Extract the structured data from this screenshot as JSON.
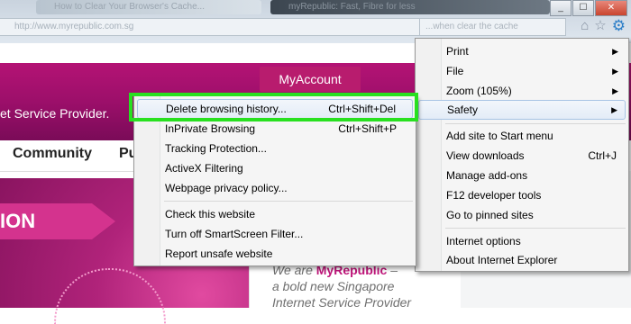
{
  "browser": {
    "tab_text": "How to Clear Your Browser's Cache...",
    "tab_text_2": "myRepublic: Fast, Fibre for less",
    "address_text": "http://www.myrepublic.com.sg",
    "search_text": "...when clear the cache",
    "window_buttons": {
      "minimize": "_",
      "maximize": "☐",
      "close": "✕"
    },
    "icons": {
      "home": "⌂",
      "favorites": "☆",
      "tools": "⚙"
    }
  },
  "page": {
    "myaccount_label": "MyAccount",
    "tagline": "et Service Provider.",
    "nav": [
      "Community",
      "Pu"
    ],
    "promo_label": "ION",
    "info": {
      "line1_prefix": "We are ",
      "line1_brand": "MyRepublic",
      "line1_suffix": " –",
      "line2": "a bold new Singapore",
      "line3": "Internet Service Provider"
    }
  },
  "tools_menu": {
    "items": [
      {
        "label": "Print",
        "submenu": true
      },
      {
        "label": "File",
        "submenu": true
      },
      {
        "label": "Zoom (105%)",
        "submenu": true
      },
      {
        "label": "Safety",
        "submenu": true,
        "highlighted": true
      },
      {
        "label": "Add site to Start menu"
      },
      {
        "label": "View downloads",
        "shortcut": "Ctrl+J"
      },
      {
        "label": "Manage add-ons"
      },
      {
        "label": "F12 developer tools"
      },
      {
        "label": "Go to pinned sites"
      },
      {
        "label": "Internet options"
      },
      {
        "label": "About Internet Explorer"
      }
    ]
  },
  "safety_menu": {
    "items": [
      {
        "label": "Delete browsing history...",
        "shortcut": "Ctrl+Shift+Del",
        "highlighted": true
      },
      {
        "label": "InPrivate Browsing",
        "shortcut": "Ctrl+Shift+P"
      },
      {
        "label": "Tracking Protection..."
      },
      {
        "label": "ActiveX Filtering"
      },
      {
        "label": "Webpage privacy policy..."
      },
      {
        "label": "Check this website"
      },
      {
        "label": "Turn off SmartScreen Filter..."
      },
      {
        "label": "Report unsafe website"
      }
    ]
  },
  "colors": {
    "brand": "#c0157a",
    "annotation_box": "#28e020",
    "menu_highlight": "#e3ecf7"
  }
}
